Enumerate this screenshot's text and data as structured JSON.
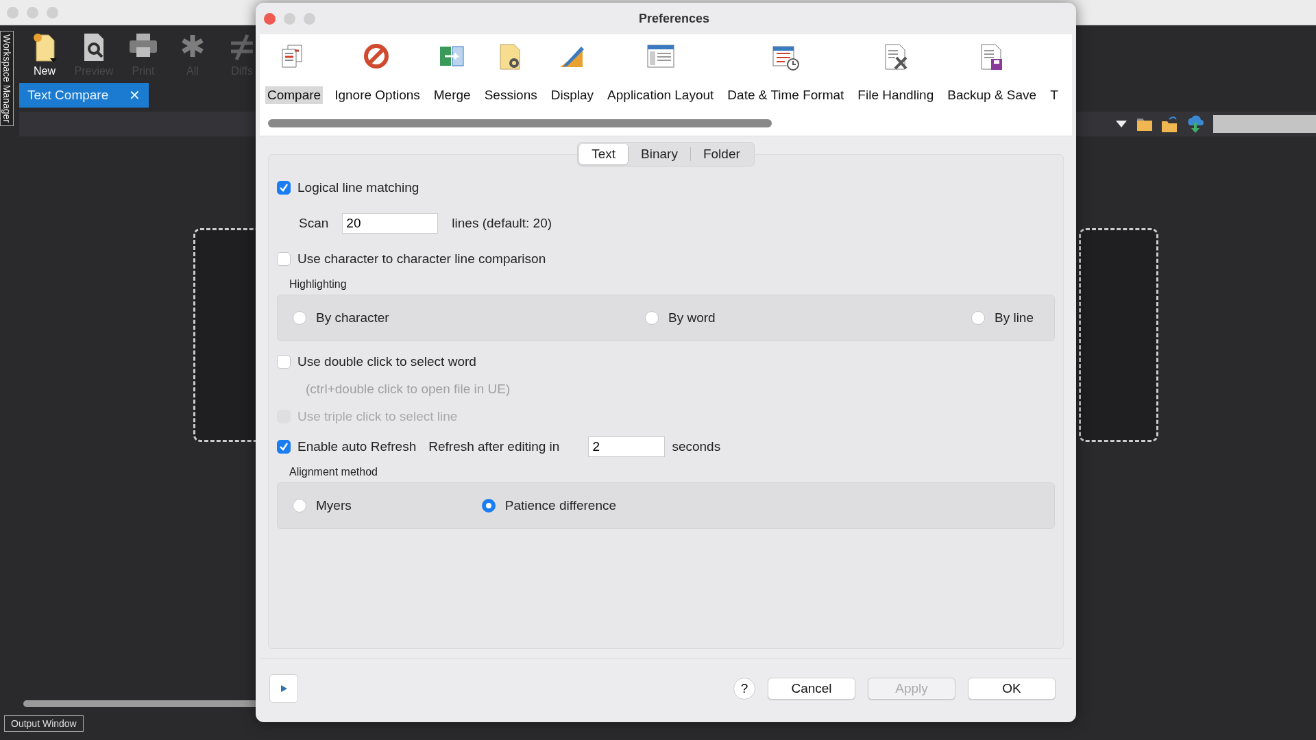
{
  "app": {
    "side_tab": "Workspace Manager",
    "toolbar": [
      {
        "label": "New",
        "disabled": false
      },
      {
        "label": "Preview",
        "disabled": true
      },
      {
        "label": "Print",
        "disabled": true
      },
      {
        "label": "All",
        "disabled": true
      },
      {
        "label": "Diffs",
        "disabled": true
      }
    ],
    "doc_tab": {
      "label": "Text Compare",
      "close": "✕"
    },
    "output_tab": "Output Window"
  },
  "dialog": {
    "title": "Preferences",
    "categories": [
      {
        "label": "Compare",
        "selected": true
      },
      {
        "label": "Ignore Options",
        "selected": false
      },
      {
        "label": "Merge",
        "selected": false
      },
      {
        "label": "Sessions",
        "selected": false
      },
      {
        "label": "Display",
        "selected": false
      },
      {
        "label": "Application Layout",
        "selected": false
      },
      {
        "label": "Date & Time Format",
        "selected": false
      },
      {
        "label": "File Handling",
        "selected": false
      },
      {
        "label": "Backup & Save",
        "selected": false
      },
      {
        "label": "T",
        "selected": false
      }
    ],
    "subtabs": [
      {
        "label": "Text",
        "selected": true
      },
      {
        "label": "Binary",
        "selected": false
      },
      {
        "label": "Folder",
        "selected": false
      }
    ],
    "options": [
      {
        "kind": "checkbox",
        "label": "Logical line matching",
        "checked": true,
        "disabled": false
      },
      {
        "kind": "field",
        "label": "Scan",
        "value": "20",
        "suffix": "lines (default: 20)"
      },
      {
        "kind": "checkbox",
        "label": "Use character to character line comparison",
        "checked": false,
        "disabled": false
      },
      {
        "kind": "radio_group",
        "title": "Highlighting",
        "options": [
          {
            "label": "By character",
            "selected": false
          },
          {
            "label": "By word",
            "selected": false
          },
          {
            "label": "By line",
            "selected": false
          }
        ]
      },
      {
        "kind": "checkbox",
        "label": "Use double click to select word",
        "checked": false,
        "disabled": false
      },
      {
        "kind": "note",
        "text": "(ctrl+double click to open file in UE)"
      },
      {
        "kind": "checkbox",
        "label": "Use triple click to select line",
        "checked": false,
        "disabled": true
      },
      {
        "kind": "checkbox",
        "label": "Enable auto Refresh",
        "checked": true,
        "disabled": false,
        "inline": {
          "label": "Refresh after editing in",
          "value": "2",
          "suffix": "seconds"
        }
      },
      {
        "kind": "radio_group",
        "title": "Alignment method",
        "options": [
          {
            "label": "Myers",
            "selected": false
          },
          {
            "label": "Patience difference",
            "selected": true
          }
        ]
      }
    ],
    "help": "?",
    "buttons": [
      {
        "label": "Cancel",
        "disabled": false
      },
      {
        "label": "Apply",
        "disabled": true
      },
      {
        "label": "OK",
        "disabled": false
      }
    ]
  }
}
